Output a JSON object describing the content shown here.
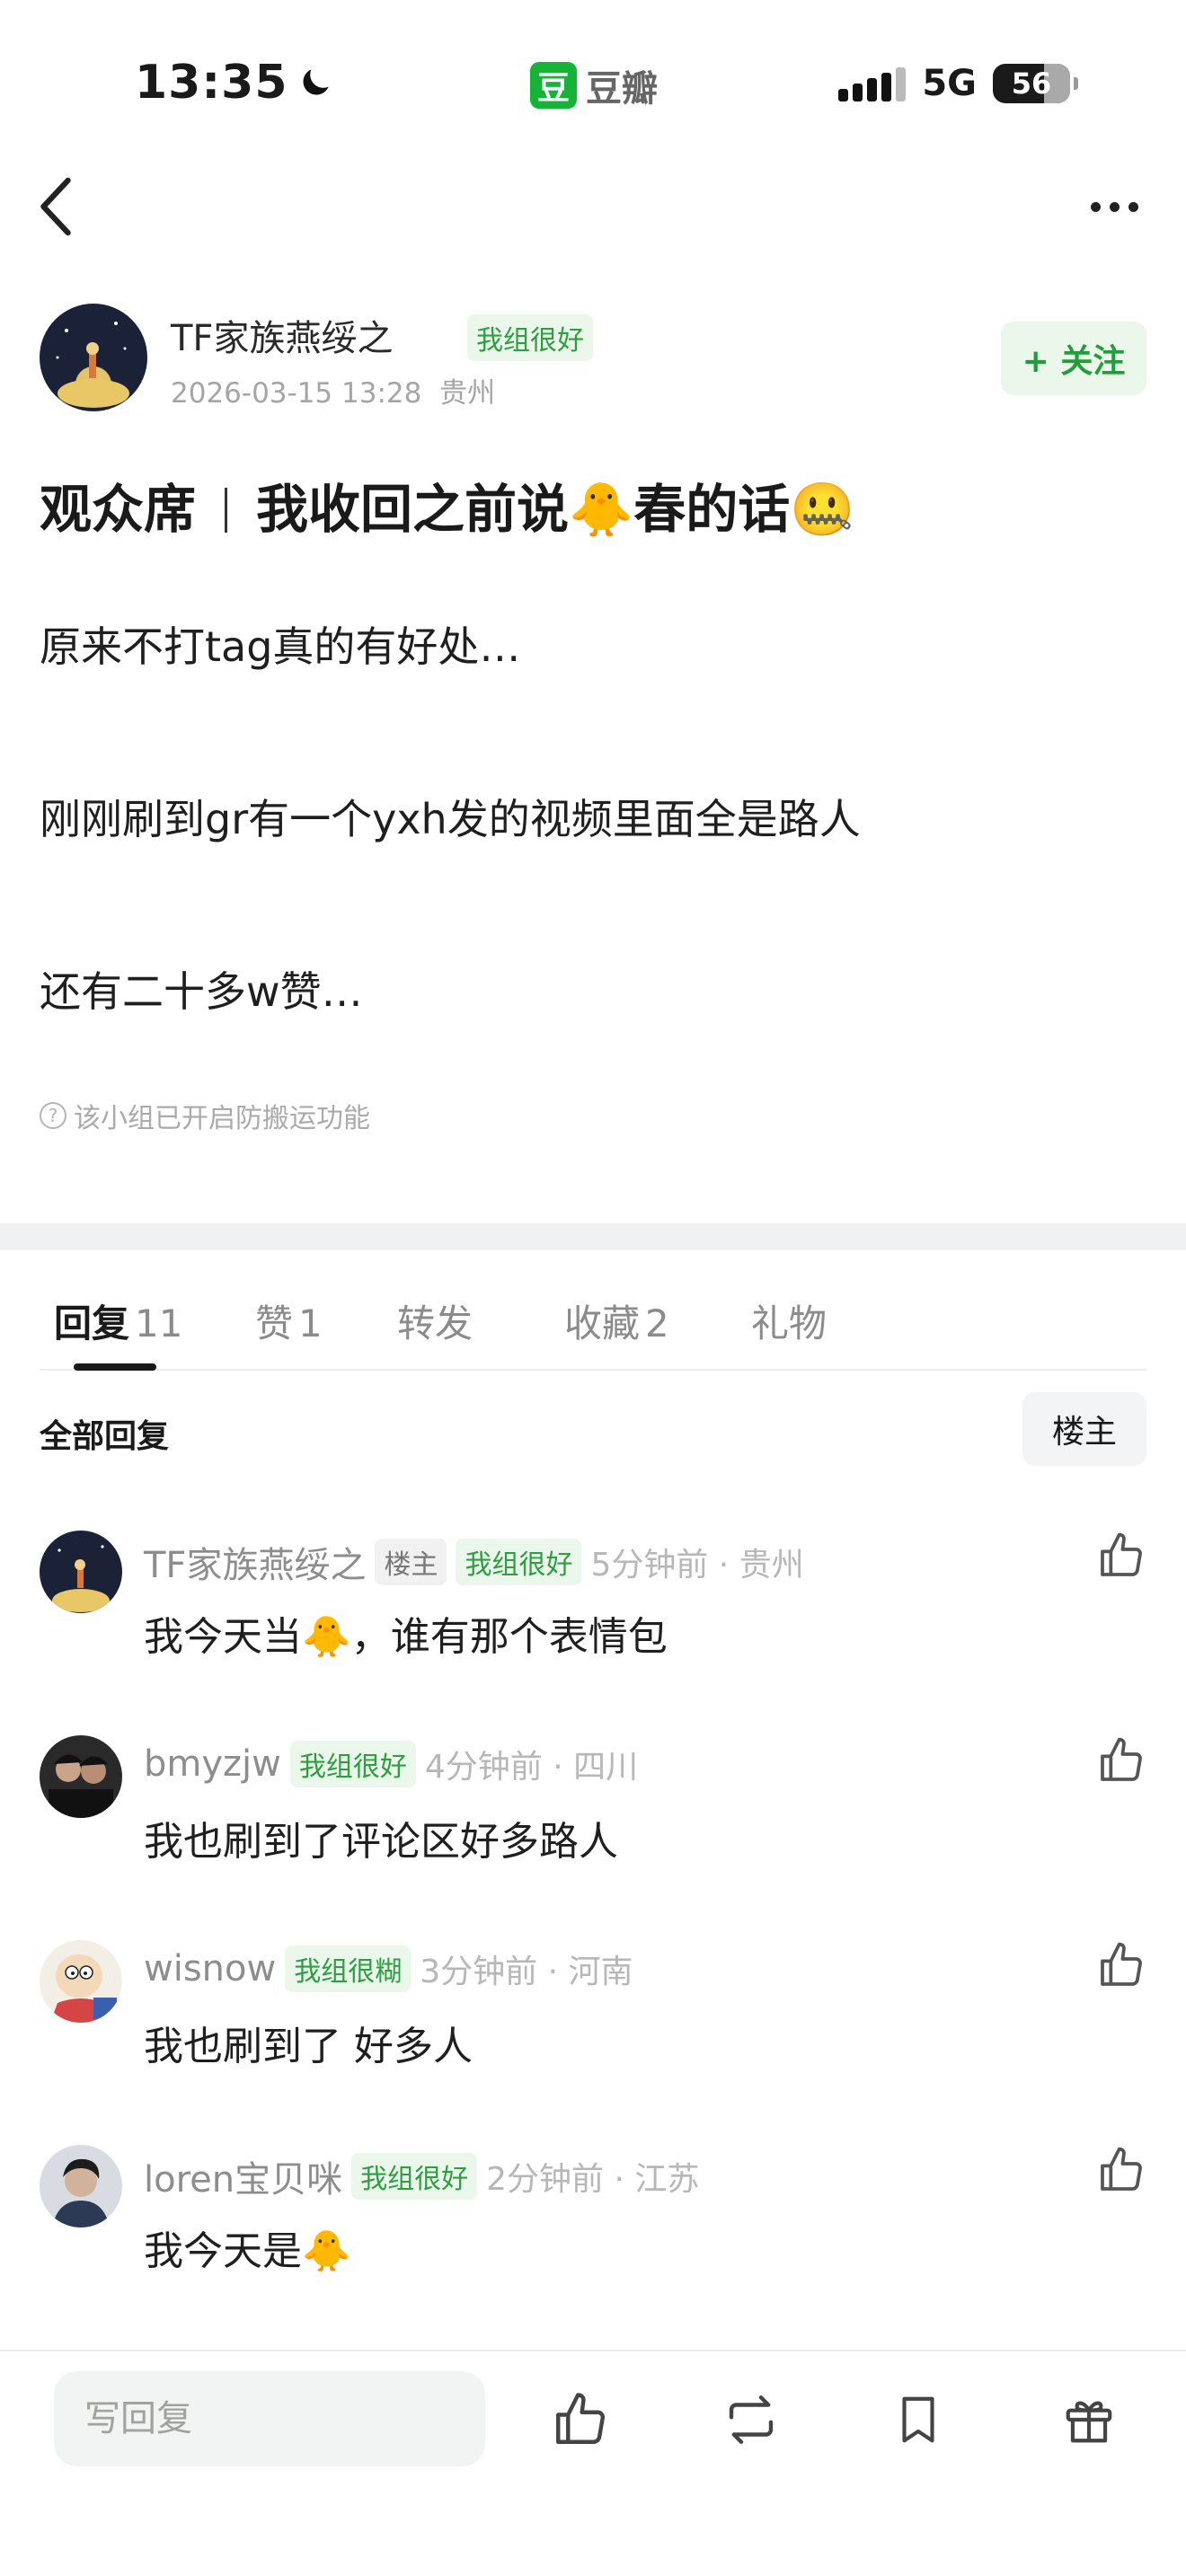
{
  "status_bar": {
    "time": "13:35",
    "app_name": "豆瓣",
    "app_logo_char": "豆",
    "network": "5G",
    "battery": "56"
  },
  "author": {
    "name": "TF家族燕绥之",
    "badge": "我组很好",
    "datetime": "2026-03-15 13:28",
    "location": "贵州",
    "follow_label": "+ 关注"
  },
  "post": {
    "category": "观众席",
    "title": "我收回之前说🐥春的话🤐",
    "lines": [
      "原来不打tag真的有好处…",
      "刚刚刷到gr有一个yxh发的视频里面全是路人",
      "还有二十多w赞…"
    ],
    "notice": "该小组已开启防搬运功能"
  },
  "tabs": [
    {
      "label": "回复",
      "count": "11",
      "active": true
    },
    {
      "label": "赞",
      "count": "1"
    },
    {
      "label": "转发",
      "count": ""
    },
    {
      "label": "收藏",
      "count": "2"
    },
    {
      "label": "礼物",
      "count": ""
    }
  ],
  "replies_header": {
    "label": "全部回复",
    "filter": "楼主"
  },
  "comments": [
    {
      "name": "TF家族燕绥之",
      "op_tag": "楼主",
      "badge": "我组很好",
      "meta": "5分钟前 · 贵州",
      "text": "我今天当🐥，谁有那个表情包",
      "avatar": "night-sky-avatar"
    },
    {
      "name": "bmyzjw",
      "op_tag": "",
      "badge": "我组很好",
      "meta": "4分钟前 · 四川",
      "text": "我也刷到了评论区好多路人",
      "avatar": "two-people-avatar"
    },
    {
      "name": "wisnow",
      "op_tag": "",
      "badge": "我组很糊",
      "meta": "3分钟前 · 河南",
      "text": "我也刷到了 好多人",
      "avatar": "cartoon-avatar"
    },
    {
      "name": "loren宝贝咪",
      "op_tag": "",
      "badge": "我组很好",
      "meta": "2分钟前 · 江苏",
      "text": "我今天是🐥",
      "avatar": "person-avatar"
    }
  ],
  "bottom_bar": {
    "reply_placeholder": "写回复",
    "icons": [
      "thumbs-up-icon",
      "repost-icon",
      "bookmark-icon",
      "gift-icon"
    ]
  },
  "colors": {
    "accent": "#1f9e3a",
    "badge_bg": "#eaf7ea",
    "logo_green": "#17b339"
  }
}
